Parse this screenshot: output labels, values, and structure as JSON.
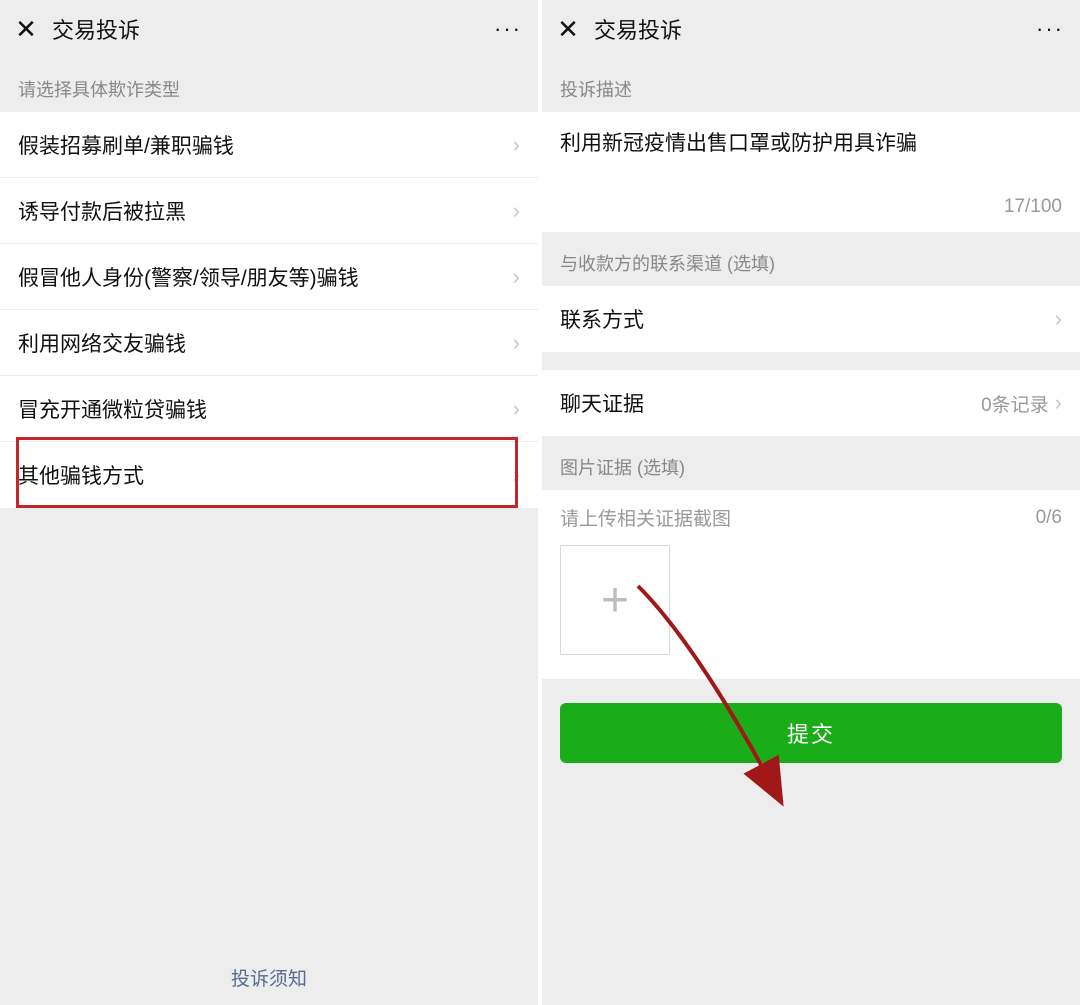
{
  "left": {
    "header_title": "交易投诉",
    "section_title": "请选择具体欺诈类型",
    "items": [
      "假装招募刷单/兼职骗钱",
      "诱导付款后被拉黑",
      "假冒他人身份(警察/领导/朋友等)骗钱",
      "利用网络交友骗钱",
      "冒充开通微粒贷骗钱",
      "其他骗钱方式"
    ],
    "footer_link": "投诉须知"
  },
  "right": {
    "header_title": "交易投诉",
    "desc_section_title": "投诉描述",
    "desc_text": "利用新冠疫情出售口罩或防护用具诈骗",
    "desc_counter": "17/100",
    "contact_section_title": "与收款方的联系渠道 (选填)",
    "contact_row_label": "联系方式",
    "chat_row_label": "聊天证据",
    "chat_row_value": "0条记录",
    "image_section_title": "图片证据 (选填)",
    "upload_hint": "请上传相关证据截图",
    "upload_counter": "0/6",
    "submit_label": "提交"
  },
  "icons": {
    "close": "✕",
    "more": "···",
    "chevron": "›",
    "plus": "+"
  }
}
